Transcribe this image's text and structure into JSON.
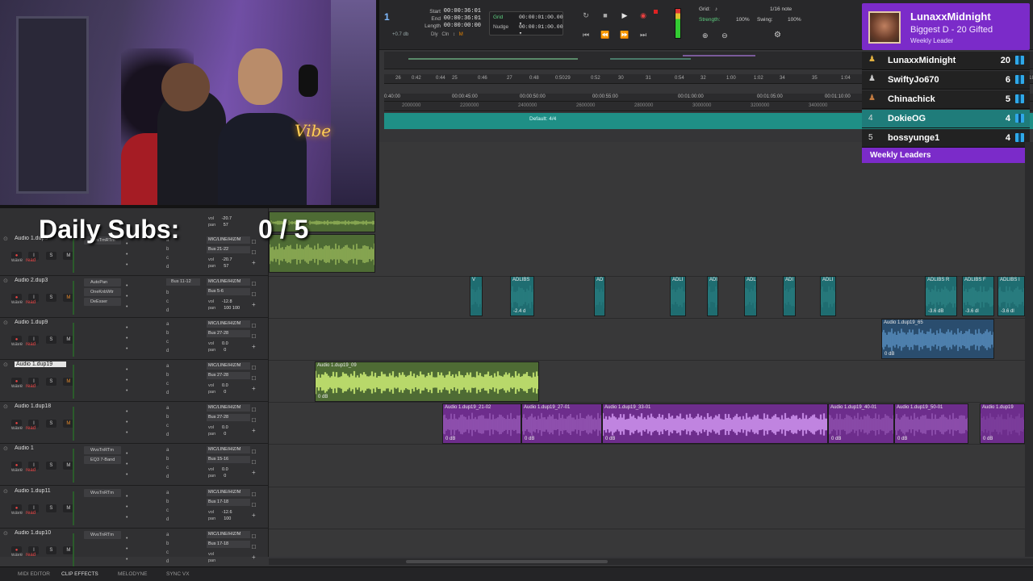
{
  "transport": {
    "counter": "1",
    "db_readout": "+0.7 db",
    "dly_items": [
      "Dly",
      "Cln",
      "↕",
      "M"
    ],
    "labels": [
      "Start",
      "End",
      "Length"
    ],
    "values": [
      "00:00:36:01",
      "00:00:36:01",
      "00:00:00:00"
    ],
    "grid_label": "Grid",
    "grid_value": "00:00:01:00.00 ▾",
    "nudge_label": "Nudge",
    "nudge_value": "00:00:01:00.00 ▾",
    "grid_right_label": "Grid:",
    "grid_right_value": "1/16 note",
    "strength_label": "Strength:",
    "strength_value": "100%",
    "swing_label": "Swing:",
    "swing_value": "100%"
  },
  "rulers": {
    "bars": [
      "26",
      "0:42",
      "0:44",
      "25",
      "0:46",
      "27",
      "0:48",
      "0:50",
      "29",
      "0:52",
      "30",
      "31",
      "0:54",
      "32",
      "1:00",
      "1:02",
      "34",
      "35",
      "1:04",
      "1:08",
      "37",
      "38",
      "1:10",
      "1:12",
      "1:14",
      "1:16",
      "1:18",
      "1:20",
      "1:22",
      "1:24"
    ],
    "timecode": [
      "0:40:00",
      "00:00:45:00",
      "00:00:50:00",
      "00:00:55:00",
      "00:01:00:00",
      "00:01:05:00",
      "00:01:10:00",
      "00:01:15:00"
    ],
    "samples": [
      "2000000",
      "2200000",
      "2400000",
      "2600000",
      "2800000",
      "3000000",
      "3200000",
      "3400000",
      "3600000"
    ],
    "meter": "Default: 4/4"
  },
  "overlay": {
    "daily_subs_label": "Daily Subs:",
    "daily_subs_count": "0 / 5",
    "neon": "Vibe"
  },
  "leaderboard": {
    "leader_name": "LunaxxMidnight",
    "leader_sub": "Biggest D - 20 Gifted",
    "leader_week": "Weekly Leader",
    "rows": [
      {
        "rank": "1",
        "name": "LunaxxMidnight",
        "count": "20"
      },
      {
        "rank": "2",
        "name": "SwiftyJo670",
        "count": "6"
      },
      {
        "rank": "3",
        "name": "Chinachick",
        "count": "5"
      },
      {
        "rank": "4",
        "name": "DokieOG",
        "count": "4"
      },
      {
        "rank": "5",
        "name": "bossyunge1",
        "count": "4"
      }
    ],
    "footer": "Weekly Leaders"
  },
  "tracks": [
    {
      "name": "Audio 1.dup3",
      "inserts": [
        "WvsTrnRTm"
      ],
      "io_in": "MIC/LINE/HIZ/M",
      "bus": "Bus 21-22",
      "vol": "-20.7",
      "pan": "57",
      "selected": false
    },
    {
      "name": "Audio 2.dup3",
      "inserts": [
        "AutoPan",
        "OneKnbWtr",
        "DeEsser"
      ],
      "send": "Bus 11-12",
      "io_in": "MIC/LINE/HIZ/M",
      "bus": "Bus 5-6",
      "vol": "-12.8",
      "pan": "100 100",
      "selected": false
    },
    {
      "name": "Audio 1.dup9",
      "inserts": [],
      "io_in": "MIC/LINE/HIZ/M",
      "bus": "Bus 27-28",
      "vol": "0.0",
      "pan": "0",
      "selected": false
    },
    {
      "name": "Audio 1.dup19",
      "inserts": [],
      "io_in": "MIC/LINE/HIZ/M",
      "bus": "Bus 27-28",
      "vol": "0.0",
      "pan": "0",
      "selected": true
    },
    {
      "name": "Audio 1.dup18",
      "inserts": [],
      "io_in": "MIC/LINE/HIZ/M",
      "bus": "Bus 27-28",
      "vol": "0.0",
      "pan": "0",
      "selected": false
    },
    {
      "name": "Audio 1",
      "inserts": [
        "WvsTnRTm",
        "EQ3 7-Band"
      ],
      "io_in": "MIC/LINE/HIZ/M",
      "bus": "Bus 15-16",
      "vol": "0.0",
      "pan": "0",
      "selected": false
    },
    {
      "name": "Audio 1.dup11",
      "inserts": [
        "WvsTnRTm"
      ],
      "io_in": "MIC/LINE/HIZ/M",
      "bus": "Bus 17-18",
      "vol": "-12.6",
      "pan": "100",
      "selected": false
    },
    {
      "name": "Audio 1.dup10",
      "inserts": [
        "WvsTnRTm"
      ],
      "io_in": "MIC/LINE/HIZ/M",
      "bus": "Bus 17-18",
      "vol": "",
      "pan": "",
      "selected": false
    }
  ],
  "track_buttons": {
    "rec": "●",
    "input": "I",
    "solo": "S",
    "mute": "M",
    "wave": "wave",
    "read": "read"
  },
  "top_track_vol": {
    "vol": "-20.7",
    "pan": "57"
  },
  "clips": [
    {
      "name": "",
      "db": "",
      "color": "green"
    },
    {
      "name": "",
      "db": "",
      "color": "green"
    },
    {
      "name": "V",
      "db": "",
      "color": "teal"
    },
    {
      "name": "ADLIBS",
      "db": "-2.4 d",
      "color": "teal"
    },
    {
      "name": "AD",
      "db": "",
      "color": "teal"
    },
    {
      "name": "ADLI",
      "db": "",
      "color": "teal"
    },
    {
      "name": "ADI",
      "db": "",
      "color": "teal"
    },
    {
      "name": "ADL",
      "db": "",
      "color": "teal"
    },
    {
      "name": "ADI",
      "db": "",
      "color": "teal"
    },
    {
      "name": "ADLI",
      "db": "",
      "color": "teal"
    },
    {
      "name": "ADLIBS R",
      "db": "-3.6 dB",
      "color": "teal"
    },
    {
      "name": "ADLIBS F",
      "db": "-3.6 dl",
      "color": "teal"
    },
    {
      "name": "ADLIBS I",
      "db": "-3.6 dl",
      "color": "teal"
    },
    {
      "name": "Audio 1.dup19_65",
      "db": "0 dB",
      "color": "blue"
    },
    {
      "name": "Audio 1.dup19_09",
      "db": "0 dB",
      "color": "green"
    },
    {
      "name": "Audio 1.dup19_21-02",
      "db": "0 dB",
      "color": "purple"
    },
    {
      "name": "Audio 1.dup19_27-01",
      "db": "0 dB",
      "color": "purple"
    },
    {
      "name": "Audio 1.dup19_33-01",
      "db": "0 dB",
      "color": "purple"
    },
    {
      "name": "Audio 1.dup19_40-01",
      "db": "0 dB",
      "color": "purple"
    },
    {
      "name": "Audio 1.dup19_50-01",
      "db": "0 dB",
      "color": "purple"
    },
    {
      "name": "Audio 1.dup19",
      "db": "0 dB",
      "color": "purple"
    }
  ],
  "bottom_tabs": [
    "MIDI EDITOR",
    "CLIP EFFECTS",
    "MELODYNE",
    "SYNC VX"
  ],
  "colors": {
    "clip_green": "#4e6b34",
    "clip_teal": "#1f6d71",
    "clip_purple": "#6d2d8c",
    "clip_blue": "#2a4d6e",
    "leaderboard_purple": "#7b2bc9",
    "meter_teal": "#1f8f86"
  }
}
